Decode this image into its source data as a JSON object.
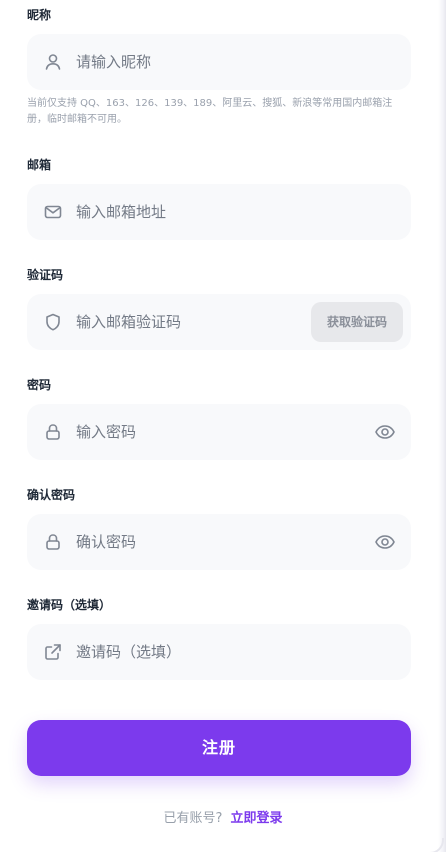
{
  "colors": {
    "accent": "#7c3aed",
    "field_bg": "#f8f9fb",
    "label": "#1f2937",
    "muted": "#98a0ab"
  },
  "nickname": {
    "label": "昵称",
    "placeholder": "请输入昵称",
    "icon": "user-icon",
    "hint": "当前仅支持 QQ、163、126、139、189、阿里云、搜狐、新浪等常用国内邮箱注册，临时邮箱不可用。"
  },
  "email": {
    "label": "邮箱",
    "placeholder": "输入邮箱地址",
    "icon": "mail-icon"
  },
  "verification": {
    "label": "验证码",
    "placeholder": "输入邮箱验证码",
    "icon": "shield-icon",
    "button": "获取验证码"
  },
  "password": {
    "label": "密码",
    "placeholder": "输入密码",
    "icon": "lock-icon",
    "toggle_icon": "eye-icon"
  },
  "confirm_password": {
    "label": "确认密码",
    "placeholder": "确认密码",
    "icon": "lock-icon",
    "toggle_icon": "eye-icon"
  },
  "invite": {
    "label": "邀请码（选填）",
    "placeholder": "邀请码（选填）",
    "icon": "external-link-icon"
  },
  "submit": {
    "label": "注册"
  },
  "footer": {
    "text": "已有账号?",
    "link": "立即登录"
  }
}
